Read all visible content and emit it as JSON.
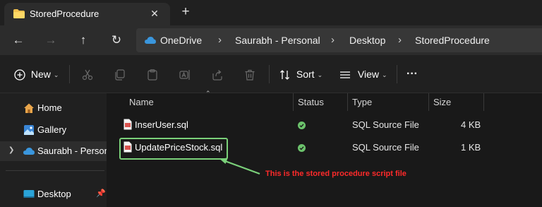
{
  "window": {
    "tab_title": "StoredProcedure",
    "close_glyph": "✕",
    "new_tab_glyph": "+"
  },
  "nav": {
    "back": "←",
    "forward": "→",
    "up": "↑",
    "refresh": "↻"
  },
  "address": {
    "separator": "›",
    "crumbs": [
      "OneDrive",
      "Saurabh - Personal",
      "Desktop",
      "StoredProcedure"
    ]
  },
  "toolbar": {
    "new_label": "New",
    "sort_label": "Sort",
    "view_label": "View",
    "more": "···"
  },
  "sidebar": {
    "items": [
      {
        "label": "Home",
        "icon": "home-icon"
      },
      {
        "label": "Gallery",
        "icon": "gallery-icon"
      },
      {
        "label": "Saurabh - Personal",
        "icon": "onedrive-icon"
      },
      {
        "label": "Desktop",
        "icon": "desktop-icon"
      }
    ]
  },
  "columns": {
    "name": "Name",
    "status": "Status",
    "type": "Type",
    "size": "Size"
  },
  "files": [
    {
      "name": "InserUser.sql",
      "type": "SQL Source File",
      "size": "4 KB"
    },
    {
      "name": "UpdatePriceStock.sql",
      "type": "SQL Source File",
      "size": "1 KB"
    }
  ],
  "annotation": {
    "text": "This is the stored procedure script file",
    "highlight_color": "#7bd17a",
    "text_color": "#ff2a2a"
  },
  "colors": {
    "accent": "#0078d4",
    "folder": "#f2c14e",
    "status_ok": "#6cc36c",
    "sql_file": "#d9534f"
  }
}
